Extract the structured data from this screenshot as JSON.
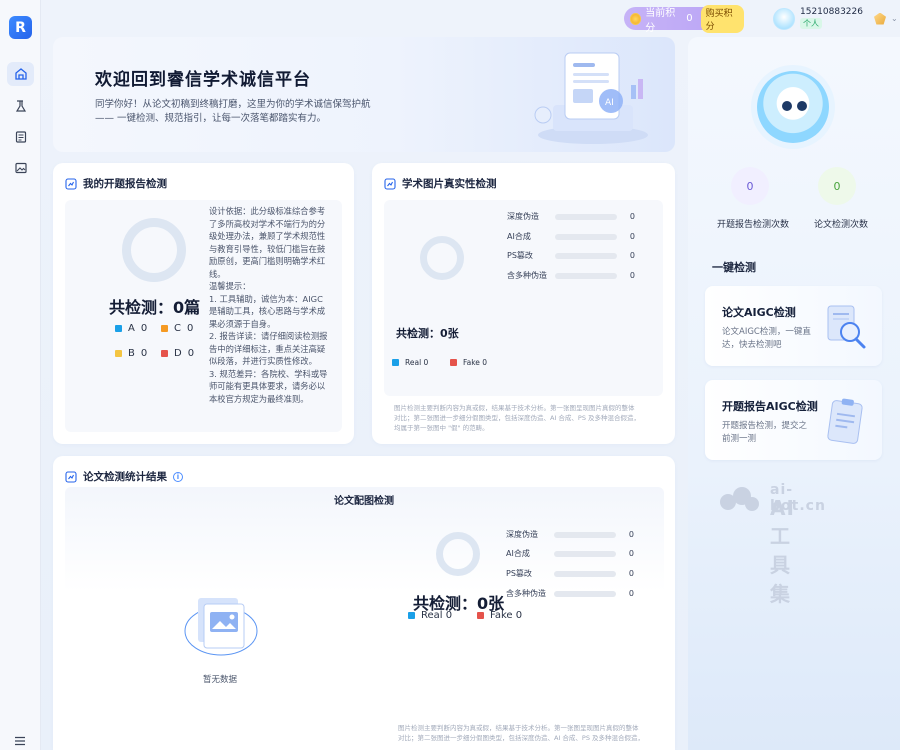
{
  "topbar": {
    "points_label": "当前积分",
    "points_value": "0",
    "buy_label": "购买积分",
    "phone": "15210883226",
    "user_tag": "个人"
  },
  "banner": {
    "title": "欢迎回到睿信学术诚信平台",
    "line1": "同学你好！从论文初稿到终稿打磨，这里为你的学术诚信保驾护航",
    "line2": "—— 一键检测、规范指引，让每一次落笔都踏实有力。"
  },
  "proposal": {
    "title": "我的开题报告检测",
    "count_text": "共检测：0篇",
    "legend": [
      {
        "label": "A",
        "value": "0",
        "color": "#1aa0e8"
      },
      {
        "label": "C",
        "value": "0",
        "color": "#f59a23"
      },
      {
        "label": "B",
        "value": "0",
        "color": "#f4c542"
      },
      {
        "label": "D",
        "value": "0",
        "color": "#e5534b"
      }
    ],
    "desc": [
      "设计依据：此分级标准综合参考",
      "了多所高校对学术不端行为的分",
      "级处理办法，兼顾了学术规范性",
      "与教育引导性，较低门槛旨在鼓",
      "励原创，更高门槛则明确学术红",
      "线。",
      "温馨提示：",
      "1. 工具辅助，诚信为本：AIGC",
      "是辅助工具，核心思路与学术成",
      "果必须源于自身。",
      "2. 报告详读：请仔细阅读检测报",
      "告中的详细标注，重点关注高疑",
      "似段落，并进行实质性修改。",
      "3. 规范差异：各院校、学科或导",
      "师可能有更具体要求，请务必以",
      "本校官方规定为最终准则。"
    ]
  },
  "image_check": {
    "title": "学术图片真实性检测",
    "count_text": "共检测：0张",
    "bars": [
      {
        "label": "深度伪造",
        "value": "0"
      },
      {
        "label": "AI合成",
        "value": "0"
      },
      {
        "label": "PS篡改",
        "value": "0"
      },
      {
        "label": "含多种伪造",
        "value": "0"
      }
    ],
    "legend_real": "Real 0",
    "legend_fake": "Fake 0",
    "note1": "图片检测主要判断内容为真或假，结果基于技术分析。第一张图呈现图片真假的整体",
    "note2": "对比；第二张图进一步细分假图类型，包括深度伪造、AI 合成、PS 及多种混合假造，",
    "note3": "均属于第一张图中 \"假\" 的范畴。"
  },
  "stats": {
    "title": "论文检测统计结果",
    "sub_title": "论文配图检测",
    "empty_text": "暂无数据",
    "count_text": "共检测：0张",
    "bars": [
      {
        "label": "深度伪造",
        "value": "0"
      },
      {
        "label": "AI合成",
        "value": "0"
      },
      {
        "label": "PS篡改",
        "value": "0"
      },
      {
        "label": "含多种伪造",
        "value": "0"
      }
    ],
    "legend_real": "Real 0",
    "legend_fake": "Fake 0",
    "note1": "图片检测主要判断内容为真或假，结果基于技术分析。第一张图呈现图片真假的整体",
    "note2": "对比；第二张图进一步细分假图类型，包括深度伪造、AI 合成、PS 及多种混合假造，",
    "note3": "均属于第一张图中 \"假\" 的范畴。"
  },
  "right": {
    "proposal_count": "0",
    "proposal_label": "开题报告检测次数",
    "paper_count": "0",
    "paper_label": "论文检测次数",
    "section_title": "一键检测",
    "card1_title": "论文AIGC检测",
    "card1_desc": "论文AIGC检测，一键直达，快去检测吧",
    "card2_title": "开题报告AIGC检测",
    "card2_desc": "开题报告检测，提交之前测一测"
  },
  "watermark": {
    "line1": "ai-bot.cn",
    "line2": "AI工具集"
  },
  "colors": {
    "accent": "#2563eb",
    "real": "#1aa0e8",
    "fake": "#e5534b"
  }
}
